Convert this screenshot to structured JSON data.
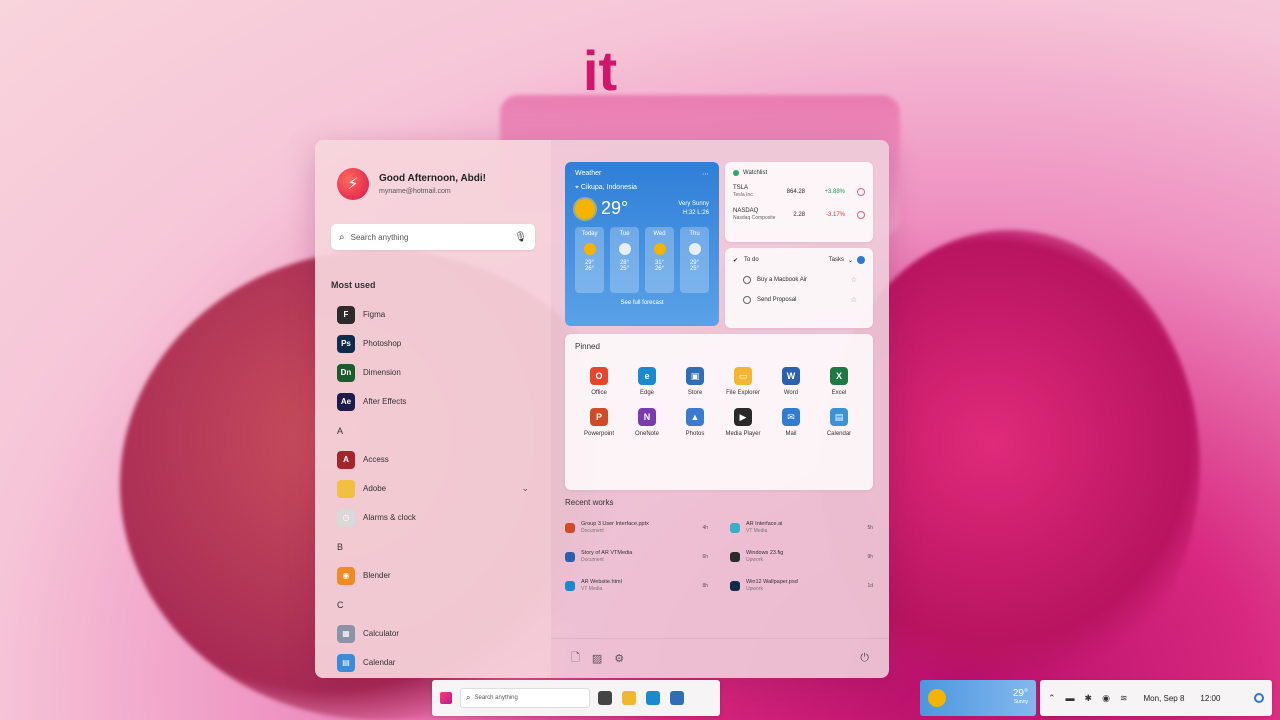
{
  "caption": "it",
  "colors": {
    "accent": "#2a7ad8",
    "overlay_text": "#d0166a",
    "stock_up": "#1a9a57",
    "stock_down": "#d23a3a"
  },
  "profile": {
    "greeting": "Good Afternoon, Abdi!",
    "email": "myname@hotmail.com",
    "avatar_icon": "lightning-icon"
  },
  "search": {
    "placeholder": "Search anything",
    "icon": "search-icon",
    "mic_icon": "microphone-icon"
  },
  "most_used": {
    "title": "Most used",
    "apps": [
      {
        "label": "Figma",
        "icon": "figma-icon",
        "color": "#2b2b2b",
        "glyph": "F"
      },
      {
        "label": "Photoshop",
        "icon": "photoshop-icon",
        "color": "#0f2b4c",
        "glyph": "Ps"
      },
      {
        "label": "Dimension",
        "icon": "dimension-icon",
        "color": "#1d5b2e",
        "glyph": "Dn"
      },
      {
        "label": "After Effects",
        "icon": "after-effects-icon",
        "color": "#1c1b4a",
        "glyph": "Ae"
      }
    ]
  },
  "all_apps": [
    {
      "letter": "A",
      "apps": [
        {
          "label": "Access",
          "icon": "access-icon",
          "color": "#a4262c",
          "glyph": "A"
        },
        {
          "label": "Adobe",
          "icon": "folder-icon",
          "color": "#f0c040",
          "glyph": "",
          "expandable": true
        },
        {
          "label": "Alarms & clock",
          "icon": "clock-icon",
          "color": "#d9d9d9",
          "glyph": "◷"
        }
      ]
    },
    {
      "letter": "B",
      "apps": [
        {
          "label": "Blender",
          "icon": "blender-icon",
          "color": "#f08a24",
          "glyph": "◉"
        }
      ]
    },
    {
      "letter": "C",
      "apps": [
        {
          "label": "Calculator",
          "icon": "calculator-icon",
          "color": "#8a94a6",
          "glyph": "▦"
        },
        {
          "label": "Calendar",
          "icon": "calendar-icon",
          "color": "#3b8bd8",
          "glyph": "▤"
        }
      ]
    }
  ],
  "weather": {
    "header": "Weather",
    "location": "Cikupa, Indonesia",
    "temperature": "29°",
    "condition": "Very Sunny",
    "condition_detail": "H:32 L:26",
    "forecast": [
      {
        "day": "Today",
        "type": "sun",
        "hi": "29°",
        "lo": "26°"
      },
      {
        "day": "Tue",
        "type": "cloud",
        "hi": "28°",
        "lo": "25°"
      },
      {
        "day": "Wed",
        "type": "sun",
        "hi": "31°",
        "lo": "26°"
      },
      {
        "day": "Thu",
        "type": "cloud",
        "hi": "29°",
        "lo": "25°"
      }
    ],
    "more": "See full forecast"
  },
  "stocks": {
    "header": "Watchlist",
    "rows": [
      {
        "symbol": "TSLA",
        "name": "Tesla Inc",
        "price": "864.28",
        "change": "+3.88%",
        "dir": "up"
      },
      {
        "symbol": "NASDAQ",
        "name": "Nasdaq Composite",
        "price": "2.28",
        "change": "-3.17%",
        "dir": "down"
      }
    ]
  },
  "todo": {
    "header": "To do",
    "list_selector": "Tasks",
    "tasks": [
      {
        "label": "Buy a Macbook Air"
      },
      {
        "label": "Send Proposal"
      }
    ]
  },
  "pinned": {
    "title": "Pinned",
    "apps": [
      {
        "label": "Office",
        "icon": "office-icon",
        "color": "#e8432b",
        "glyph": "O"
      },
      {
        "label": "Edge",
        "icon": "edge-icon",
        "color": "#1a8ad0",
        "glyph": "e"
      },
      {
        "label": "Store",
        "icon": "store-icon",
        "color": "#2f6db5",
        "glyph": "▣"
      },
      {
        "label": "File Explorer",
        "icon": "folder-icon",
        "color": "#f2b630",
        "glyph": "▭"
      },
      {
        "label": "Word",
        "icon": "word-icon",
        "color": "#2b5fb0",
        "glyph": "W"
      },
      {
        "label": "Excel",
        "icon": "excel-icon",
        "color": "#1e7a45",
        "glyph": "X"
      },
      {
        "label": "Powerpoint",
        "icon": "powerpoint-icon",
        "color": "#d24a26",
        "glyph": "P"
      },
      {
        "label": "OneNote",
        "icon": "onenote-icon",
        "color": "#7a3bb0",
        "glyph": "N"
      },
      {
        "label": "Photos",
        "icon": "photos-icon",
        "color": "#3a7ad0",
        "glyph": "▲"
      },
      {
        "label": "Media Player",
        "icon": "media-player-icon",
        "color": "#2a2a2a",
        "glyph": "▶"
      },
      {
        "label": "Mail",
        "icon": "mail-icon",
        "color": "#2f7cd2",
        "glyph": "✉"
      },
      {
        "label": "Calendar",
        "icon": "calendar-icon",
        "color": "#3a92d8",
        "glyph": "▤"
      }
    ]
  },
  "recent": {
    "title": "Recent works",
    "items": [
      {
        "name": "Group 3 User Interface.pptx",
        "source": "Document",
        "time": "4h",
        "icon": "powerpoint-file-icon",
        "color": "#d24a26"
      },
      {
        "name": "AR Interface.ai",
        "source": "VT Media",
        "time": "5h",
        "icon": "image-file-icon",
        "color": "#3aaec8"
      },
      {
        "name": "Story of AR VTMedia",
        "source": "Document",
        "time": "6h",
        "icon": "word-file-icon",
        "color": "#2b5fb0"
      },
      {
        "name": "Windows 23.fig",
        "source": "Upwork",
        "time": "9h",
        "icon": "figma-file-icon",
        "color": "#2b2b2b"
      },
      {
        "name": "AR Website.html",
        "source": "VT Media",
        "time": "8h",
        "icon": "edge-file-icon",
        "color": "#1a8ad0"
      },
      {
        "name": "Win12 Wallpaper.psd",
        "source": "Upwork",
        "time": "1d",
        "icon": "photoshop-file-icon",
        "color": "#0f2b4c"
      }
    ]
  },
  "footer": {
    "doc_icon": "document-icon",
    "image_icon": "image-icon",
    "settings_icon": "gear-icon",
    "power_icon": "power-icon"
  },
  "taskbar": {
    "search_placeholder": "Search anything",
    "apps": [
      {
        "icon": "task-view-icon",
        "color": "#444"
      },
      {
        "icon": "folder-icon",
        "color": "#f2b630"
      },
      {
        "icon": "edge-icon",
        "color": "#1a8ad0"
      },
      {
        "icon": "store-icon",
        "color": "#2f6db5"
      }
    ],
    "weather_temp": "29°",
    "weather_cond": "Sunny",
    "date": "Mon, Sep 8",
    "time": "12:00"
  }
}
